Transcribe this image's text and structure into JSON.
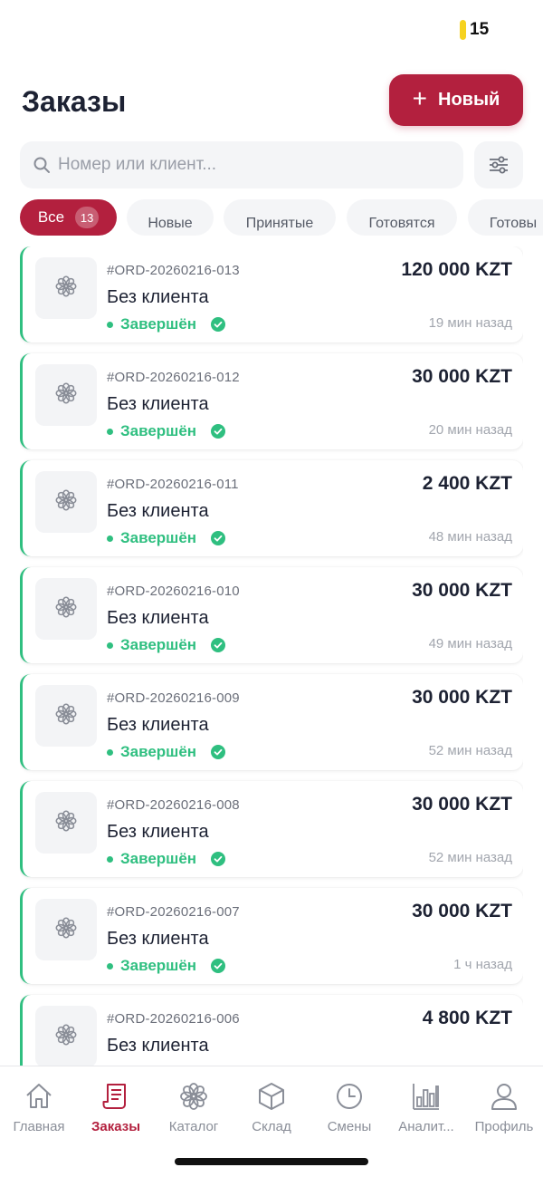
{
  "status_bar": {
    "battery": "15",
    "battery_color": "#f6d21f"
  },
  "header": {
    "title": "Заказы",
    "new_button_label": "Новый"
  },
  "search": {
    "placeholder": "Номер или клиент..."
  },
  "filters": [
    {
      "label": "Все",
      "count": "13",
      "active": true
    },
    {
      "label": "Новые"
    },
    {
      "label": "Принятые"
    },
    {
      "label": "Готовятся"
    },
    {
      "label": "Готовы"
    }
  ],
  "orders": [
    {
      "id": "#ORD-20260216-013",
      "client": "Без клиента",
      "status": "Завершён",
      "total": "120 000 KZT",
      "time": "19 мин назад"
    },
    {
      "id": "#ORD-20260216-012",
      "client": "Без клиента",
      "status": "Завершён",
      "total": "30 000 KZT",
      "time": "20 мин назад"
    },
    {
      "id": "#ORD-20260216-011",
      "client": "Без клиента",
      "status": "Завершён",
      "total": "2 400 KZT",
      "time": "48 мин назад"
    },
    {
      "id": "#ORD-20260216-010",
      "client": "Без клиента",
      "status": "Завершён",
      "total": "30 000 KZT",
      "time": "49 мин назад"
    },
    {
      "id": "#ORD-20260216-009",
      "client": "Без клиента",
      "status": "Завершён",
      "total": "30 000 KZT",
      "time": "52 мин назад"
    },
    {
      "id": "#ORD-20260216-008",
      "client": "Без клиента",
      "status": "Завершён",
      "total": "30 000 KZT",
      "time": "52 мин назад"
    },
    {
      "id": "#ORD-20260216-007",
      "client": "Без клиента",
      "status": "Завершён",
      "total": "30 000 KZT",
      "time": "1 ч назад"
    },
    {
      "id": "#ORD-20260216-006",
      "client": "Без клиента",
      "status": "",
      "total": "4 800 KZT",
      "time": ""
    }
  ],
  "nav": [
    {
      "label": "Главная",
      "icon": "home-icon"
    },
    {
      "label": "Заказы",
      "icon": "orders-icon",
      "active": true
    },
    {
      "label": "Каталог",
      "icon": "flower-icon"
    },
    {
      "label": "Склад",
      "icon": "box-icon"
    },
    {
      "label": "Смены",
      "icon": "clock-icon"
    },
    {
      "label": "Аналит...",
      "icon": "chart-icon"
    },
    {
      "label": "Профиль",
      "icon": "user-icon"
    }
  ],
  "colors": {
    "accent": "#b3203e",
    "success": "#2fbf80"
  }
}
